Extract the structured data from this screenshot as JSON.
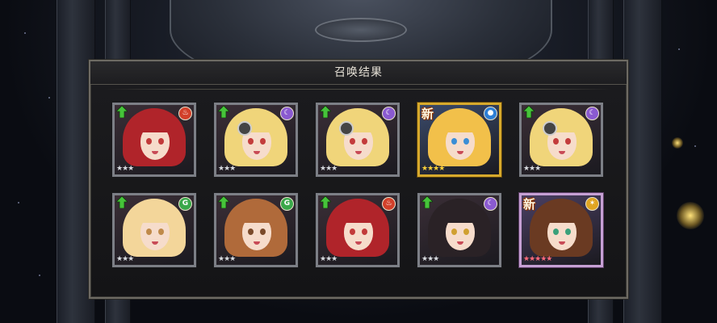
{
  "dialog": {
    "title": "召唤结果"
  },
  "colors": {
    "fire": "#d2402a",
    "dark": "#8a5ad0",
    "water": "#2d7fd6",
    "wind": "#3aa84a",
    "light": "#e0a522",
    "up_arrow": "#46c43a"
  },
  "results": [
    {
      "name": "red-hair-elf",
      "element": "fire",
      "element_icon": "fire-icon",
      "frame": "silver",
      "rarity": 3,
      "up": true,
      "new": false,
      "hair": "#b0242a",
      "eye": "#c23a3a"
    },
    {
      "name": "blonde-mask",
      "element": "dark",
      "element_icon": "moon-icon",
      "frame": "silver",
      "rarity": 3,
      "up": true,
      "new": false,
      "hair": "#f0d57a",
      "eye": "#c33c3c"
    },
    {
      "name": "blonde-mask",
      "element": "dark",
      "element_icon": "moon-icon",
      "frame": "silver",
      "rarity": 3,
      "up": true,
      "new": false,
      "hair": "#f0d57a",
      "eye": "#c33c3c"
    },
    {
      "name": "blonde-twin",
      "element": "water",
      "element_icon": "water-drop-icon",
      "frame": "gold",
      "rarity": 4,
      "up": false,
      "new": true,
      "new_label": "新",
      "hair": "#f2c04a",
      "eye": "#3a8ed6"
    },
    {
      "name": "blonde-mask",
      "element": "dark",
      "element_icon": "moon-icon",
      "frame": "silver",
      "rarity": 3,
      "up": true,
      "new": false,
      "hair": "#f0d57a",
      "eye": "#c33c3c"
    },
    {
      "name": "flower-blonde",
      "element": "wind",
      "element_icon": "wind-icon",
      "frame": "silver",
      "rarity": 3,
      "up": true,
      "new": false,
      "hair": "#f3d69a",
      "eye": "#c08a4a"
    },
    {
      "name": "brown-flower",
      "element": "wind",
      "element_icon": "wind-icon",
      "frame": "silver",
      "rarity": 3,
      "up": true,
      "new": false,
      "hair": "#b06a3a",
      "eye": "#7a4a2a"
    },
    {
      "name": "red-hair-elf",
      "element": "fire",
      "element_icon": "fire-icon",
      "frame": "silver",
      "rarity": 3,
      "up": true,
      "new": false,
      "hair": "#b0242a",
      "eye": "#c23a3a"
    },
    {
      "name": "black-hair-elf",
      "element": "dark",
      "element_icon": "moon-icon",
      "frame": "silver",
      "rarity": 3,
      "up": true,
      "new": false,
      "hair": "#2a2226",
      "eye": "#d0a030"
    },
    {
      "name": "brown-long-hair",
      "element": "light",
      "element_icon": "sun-icon",
      "frame": "rainbow",
      "rarity": 5,
      "up": false,
      "new": true,
      "new_label": "新",
      "hair": "#6a3a22",
      "eye": "#3aa07a"
    }
  ]
}
